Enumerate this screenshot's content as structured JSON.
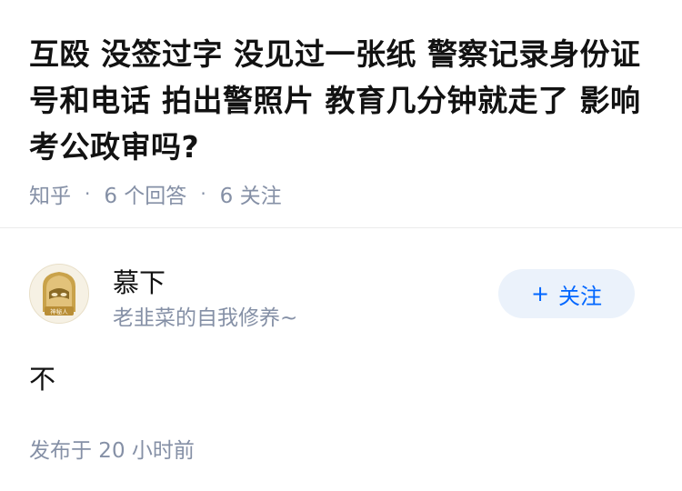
{
  "question": {
    "title": "互殴 没签过字 没见过一张纸 警察记录身份证号和电话 拍出警照片 教育几分钟就走了 影响考公政审吗?",
    "source": "知乎",
    "separator": "·",
    "answer_count": "6 个回答",
    "follow_count": "6 关注"
  },
  "answer": {
    "author": {
      "name": "慕下",
      "bio": "老韭菜的自我修养~",
      "avatar_icon": "mystery-person-avatar-icon",
      "avatar_caption": "神秘人"
    },
    "follow_button": {
      "plus": "+",
      "label": "关注"
    },
    "content": "不",
    "time": "发布于  20 小时前"
  },
  "colors": {
    "title": "#121212",
    "meta": "#8590a6",
    "accent": "#0066ff",
    "follow_bg": "#ebf2fb",
    "avatar_gold": "#c9a24a"
  }
}
